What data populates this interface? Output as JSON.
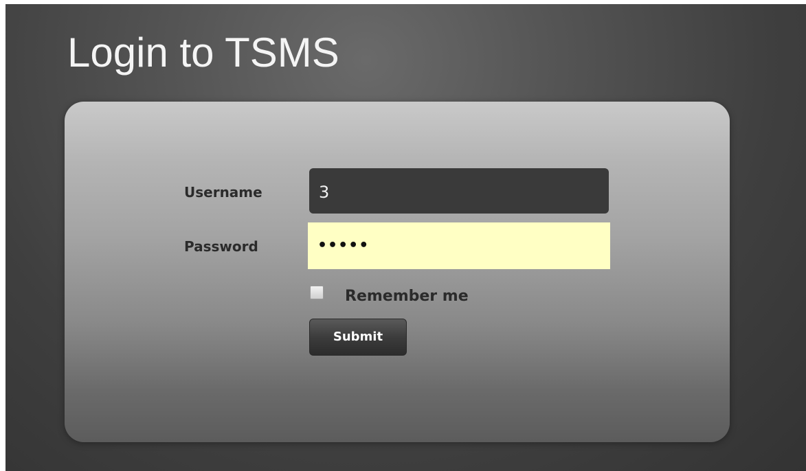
{
  "page": {
    "title": "Login to TSMS"
  },
  "form": {
    "username_label": "Username",
    "username_value": "3",
    "password_label": "Password",
    "password_value": "•••••",
    "remember_label": "Remember me",
    "remember_checked": false,
    "submit_label": "Submit"
  },
  "colors": {
    "background": "#444444",
    "title": "#f4f4f4",
    "username_field": "#3a3a3a",
    "password_field": "#ffffc4",
    "submit_button": "#3c3c3c"
  },
  "icons": {
    "checkbox": "checkbox-unchecked-icon"
  }
}
